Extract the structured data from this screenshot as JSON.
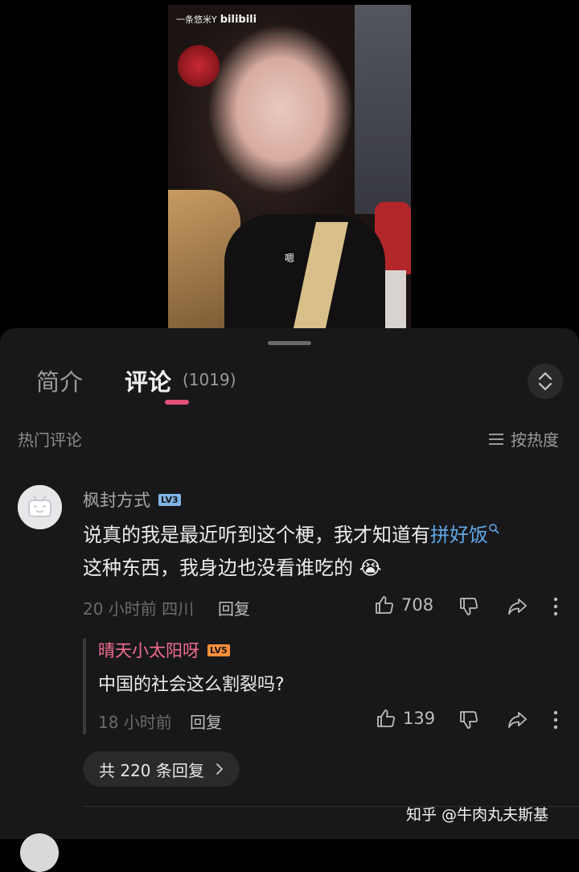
{
  "video": {
    "watermark_text": "一条悠米Y",
    "watermark_brand": "bilibili",
    "subtitle": "嗯"
  },
  "tabs": {
    "intro": "简介",
    "comments": "评论",
    "comment_count": "(1019)"
  },
  "section": {
    "hot_comments": "热门评论",
    "sort_label": "按热度"
  },
  "comment": {
    "username": "枫封方式",
    "level": "LV3",
    "text_before_link": "说真的我是最近听到这个梗，我才知道有",
    "link_text": "拼好饭",
    "text_after_link": "这种东西，我身边也没看谁吃的",
    "emoji": "😭",
    "time_location": "20 小时前 四川",
    "reply_label": "回复",
    "like_count": "708"
  },
  "reply": {
    "username": "晴天小太阳呀",
    "level": "LV5",
    "text": "中国的社会这么割裂吗?",
    "time": "18 小时前",
    "reply_label": "回复",
    "like_count": "139"
  },
  "more_replies": {
    "label": "共 220 条回复"
  },
  "watermark": {
    "text": "知乎 @牛肉丸夫斯基"
  },
  "colors": {
    "accent_pink": "#e2507a",
    "link_blue": "#5fa7e6",
    "reply_user_pink": "#f06d8e",
    "lv3": "#7fb4e6",
    "lv5": "#ff8e3a"
  }
}
